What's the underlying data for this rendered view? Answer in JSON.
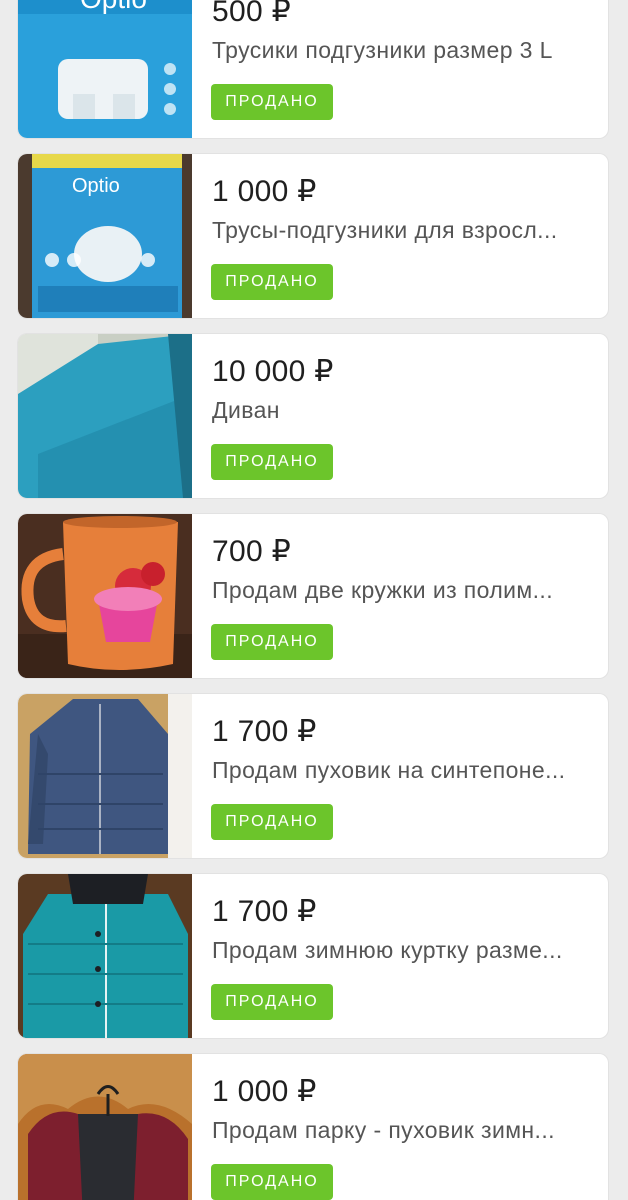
{
  "listings": [
    {
      "price": "500 ₽",
      "title": "Трусики подгузники размер 3 L",
      "status": "ПРОДАНО",
      "image": "adult-diaper-pack-photo"
    },
    {
      "price": "1 000 ₽",
      "title": "Трусы-подгузники для взросл...",
      "status": "ПРОДАНО",
      "image": "adult-diaper-pack-photo"
    },
    {
      "price": "10 000 ₽",
      "title": "Диван",
      "status": "ПРОДАНО",
      "image": "blue-sofa-photo"
    },
    {
      "price": "700 ₽",
      "title": "Продам две кружки из полим...",
      "status": "ПРОДАНО",
      "image": "orange-mug-photo"
    },
    {
      "price": "1 700 ₽",
      "title": "Продам пуховик на синтепоне...",
      "status": "ПРОДАНО",
      "image": "blue-puffer-coat-photo"
    },
    {
      "price": "1 700 ₽",
      "title": "Продам зимнюю куртку разме...",
      "status": "ПРОДАНО",
      "image": "teal-winter-jacket-photo"
    },
    {
      "price": "1 000 ₽",
      "title": "Продам парку - пуховик зимн...",
      "status": "ПРОДАНО",
      "image": "burgundy-parka-photo"
    }
  ],
  "colors": {
    "badge_green": "#6cc52b",
    "background": "#ececec",
    "card": "#ffffff"
  }
}
